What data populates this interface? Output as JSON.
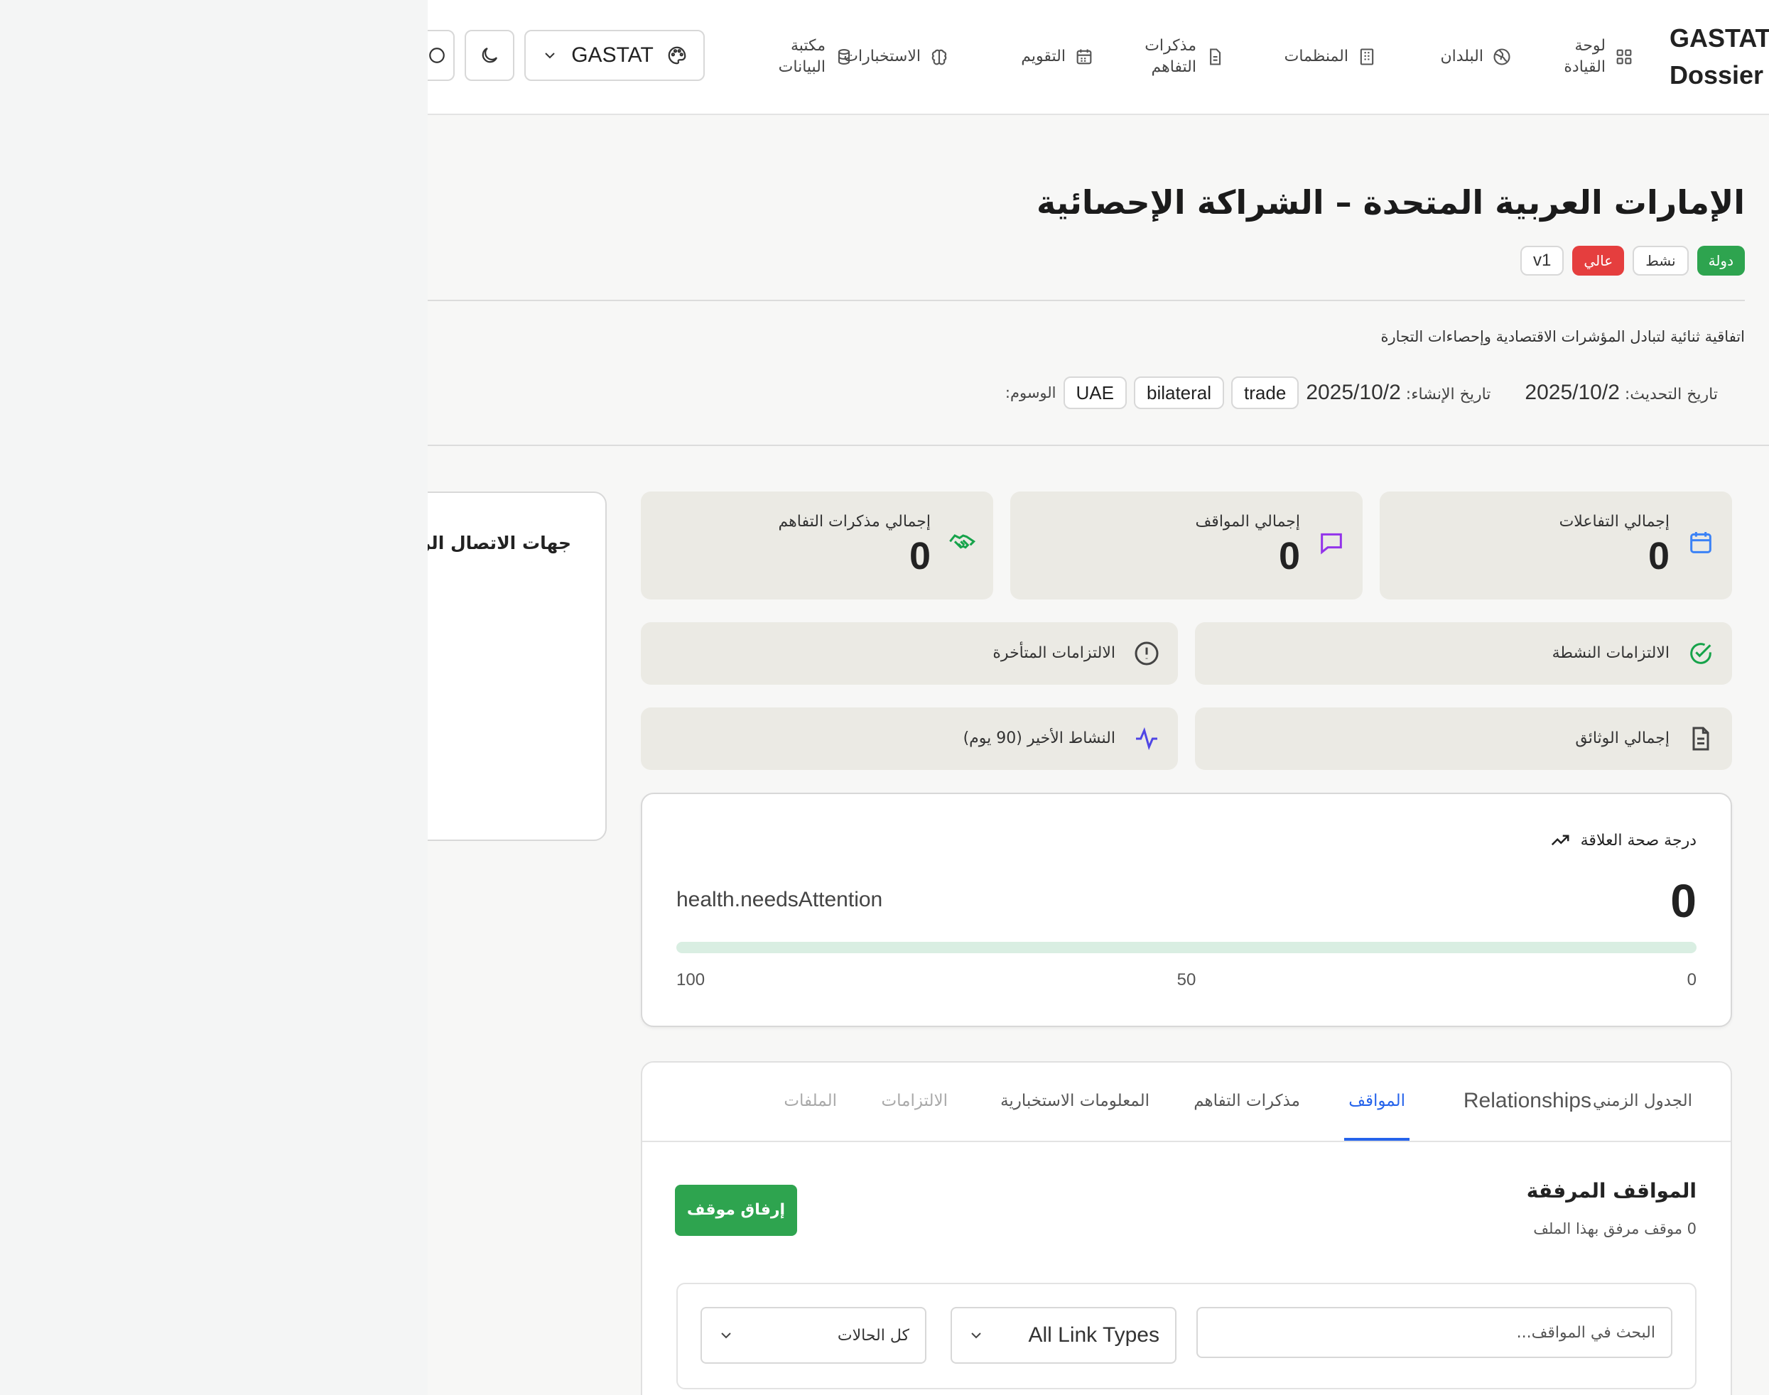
{
  "header": {
    "brand": "GASTAT Dossier",
    "nav": [
      {
        "label": "لوحة القيادة",
        "icon": "dashboard-grid-icon"
      },
      {
        "label": "البلدان",
        "icon": "globe-icon"
      },
      {
        "label": "المنظمات",
        "icon": "building-icon"
      },
      {
        "label": "مذكرات التفاهم",
        "icon": "file-icon"
      },
      {
        "label": "التقويم",
        "icon": "calendar-icon"
      },
      {
        "label": "الاستخبارات",
        "icon": "brain-icon"
      },
      {
        "label": "مكتبة البيانات",
        "icon": "database-icon"
      }
    ],
    "theme_select": {
      "value": "GASTAT",
      "icon": "palette-icon"
    },
    "dark_mode_icon": "moon-icon"
  },
  "dossier": {
    "title": "الإمارات العربية المتحدة – الشراكة الإحصائية",
    "badges": {
      "type": "دولة",
      "status": "نشط",
      "priority": "عالي",
      "version": "v1"
    },
    "description": "اتفاقية ثنائية لتبادل المؤشرات الاقتصادية وإحصاءات التجارة",
    "tags_label": "الوسوم:",
    "tags": [
      "UAE",
      "bilateral",
      "trade"
    ],
    "created_label": "تاريخ الإنشاء:",
    "created_value": "2025/10/2",
    "updated_label": "تاريخ التحديث:",
    "updated_value": "2025/10/2"
  },
  "stats": {
    "interactions": {
      "label": "إجمالي التفاعلات",
      "value": "0",
      "icon": "calendar-icon"
    },
    "positions": {
      "label": "إجمالي المواقف",
      "value": "0",
      "icon": "message-square-icon"
    },
    "mous": {
      "label": "إجمالي مذكرات التفاهم",
      "value": "0",
      "icon": "handshake-icon"
    },
    "active_commitments": {
      "label": "الالتزامات النشطة",
      "icon": "check-circle-icon"
    },
    "overdue_commitments": {
      "label": "الالتزامات المتأخرة",
      "icon": "alert-circle-icon"
    },
    "documents": {
      "label": "إجمالي الوثائق",
      "icon": "file-text-icon"
    },
    "recent_activity": {
      "label": "النشاط الأخير (90 يوم)",
      "icon": "activity-icon"
    }
  },
  "health": {
    "title": "درجة صحة العلاقة",
    "value": "0",
    "status": "health.needsAttention",
    "fill_percent": 0,
    "scale": {
      "min": "0",
      "mid": "50",
      "max": "100"
    },
    "colors": {
      "track": "#d9eee2",
      "fill": "#2ea44f"
    }
  },
  "contacts": {
    "title": "جهات الاتصال الرئيسية"
  },
  "tabs": {
    "timeline": "الجدول الزمني",
    "relationships": "Relationships",
    "positions": "المواقف",
    "mous": "مذكرات التفاهم",
    "intelligence": "المعلومات الاستخبارية",
    "commitments": "الالتزامات",
    "files": "الملفات"
  },
  "positions_section": {
    "title": "المواقف المرفقة",
    "subtitle": "0 موقف مرفق بهذا الملف",
    "attach_button": "إرفاق موقف",
    "search_placeholder": "البحث في المواقف...",
    "link_type_select": "All Link Types",
    "status_select": "كل الحالات"
  },
  "colors": {
    "accent": "#2563eb",
    "success": "#2ea44f",
    "danger": "#e53e3e",
    "card_bg": "#ebeae4"
  }
}
